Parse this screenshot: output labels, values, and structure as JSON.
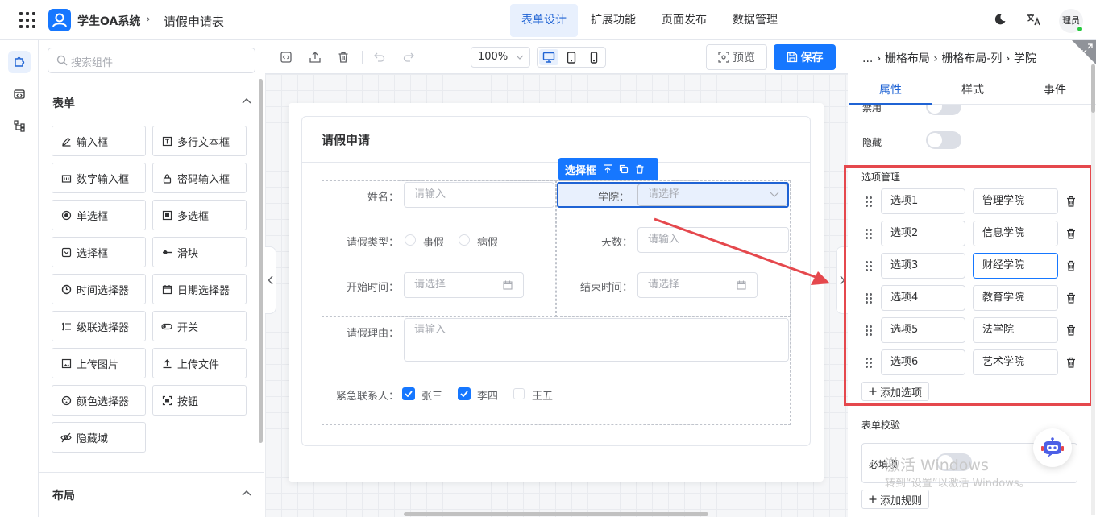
{
  "header": {
    "brand": "学生OA系统",
    "separator": "›",
    "page": "请假申请表",
    "nav": [
      "表单设计",
      "扩展功能",
      "页面发布",
      "数据管理"
    ],
    "avatar": "理员"
  },
  "panel": {
    "search_placeholder": "搜索组件",
    "section_form": "表单",
    "section_layout": "布局",
    "components": [
      "输入框",
      "多行文本框",
      "数字输入框",
      "密码输入框",
      "单选框",
      "多选框",
      "选择框",
      "滑块",
      "时间选择器",
      "日期选择器",
      "级联选择器",
      "开关",
      "上传图片",
      "上传文件",
      "颜色选择器",
      "按钮",
      "隐藏域"
    ]
  },
  "toolbar": {
    "zoom": "100%",
    "preview_label": "预览",
    "save_label": "保存"
  },
  "form": {
    "title": "请假申请",
    "name_label": "姓名：",
    "name_placeholder": "请输入",
    "college_label": "学院：",
    "college_placeholder": "请选择",
    "type_label": "请假类型：",
    "type_options": [
      "事假",
      "病假"
    ],
    "days_label": "天数：",
    "days_placeholder": "请输入",
    "start_label": "开始时间：",
    "start_placeholder": "请选择",
    "end_label": "结束时间：",
    "end_placeholder": "请选择",
    "reason_label": "请假理由：",
    "reason_placeholder": "请输入",
    "contact_label": "紧急联系人：",
    "contacts": [
      {
        "label": "张三",
        "checked": true
      },
      {
        "label": "李四",
        "checked": true
      },
      {
        "label": "王五",
        "checked": false
      }
    ],
    "selected_tag": "选择框"
  },
  "right": {
    "breadcrumb": "... › 栅格布局 › 栅格布局-列 › 学院",
    "tabs": [
      "属性",
      "样式",
      "事件"
    ],
    "disabled_label": "禁用",
    "hidden_label": "隐藏",
    "options_title": "选项管理",
    "options": [
      {
        "key": "选项1",
        "value": "管理学院"
      },
      {
        "key": "选项2",
        "value": "信息学院"
      },
      {
        "key": "选项3",
        "value": "财经学院"
      },
      {
        "key": "选项4",
        "value": "教育学院"
      },
      {
        "key": "选项5",
        "value": "法学院"
      },
      {
        "key": "选项6",
        "value": "艺术学院"
      }
    ],
    "add_option": "添加选项",
    "validation_title": "表单校验",
    "required_label": "必填项",
    "add_rule": "添加规则"
  },
  "watermark": {
    "line1": "激活 Windows",
    "line2": "转到“设置”以激活 Windows。"
  },
  "colors": {
    "primary": "#1677ff",
    "highlight": "#e5484d"
  }
}
